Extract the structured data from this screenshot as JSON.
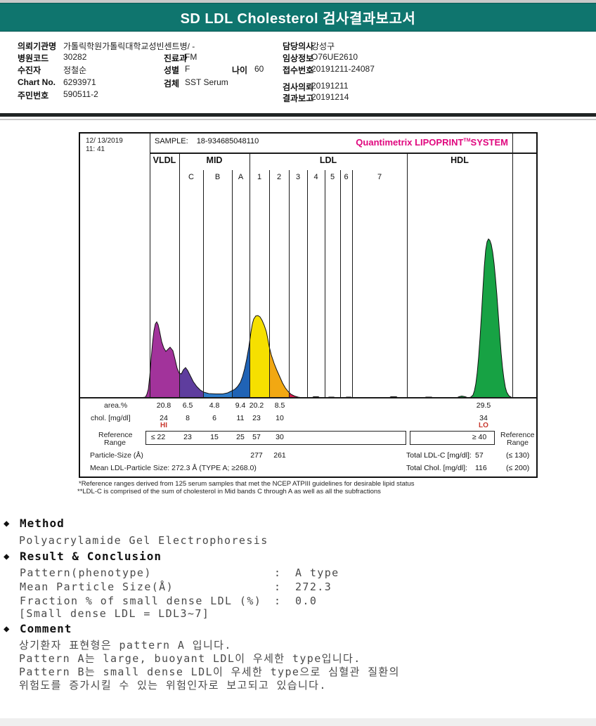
{
  "header": {
    "title": "SD LDL Cholesterol 검사결과보고서"
  },
  "patient": {
    "col1": [
      {
        "label": "의뢰기관명",
        "value": "가톨릭학원가톨릭대학교성빈센트병/ -"
      },
      {
        "label": "병원코드",
        "value": "30282"
      },
      {
        "label": "수진자",
        "value": "정철순"
      },
      {
        "label": "Chart No.",
        "value": "6293971"
      },
      {
        "label": "주민번호",
        "value": "590511-2"
      }
    ],
    "col2": [
      {
        "label": "진료과",
        "value": "FM"
      },
      {
        "label": "성별",
        "value": "F"
      },
      {
        "label": "나이",
        "value": "60"
      },
      {
        "label": "검체",
        "value": "SST Serum"
      }
    ],
    "col3": [
      {
        "label": "담당의사",
        "value": "강성구"
      },
      {
        "label": "임상정보",
        "value": "O76UE2610"
      },
      {
        "label": "접수번호",
        "value": "20191211-24087"
      },
      {
        "label": "검사의뢰",
        "value": "20191211"
      },
      {
        "label": "결과보고",
        "value": "20191214"
      }
    ]
  },
  "chart_data": {
    "type": "area",
    "title": "Quantimetrix LIPOPRINT SYSTEM densitometry scan",
    "date_line1": "12/ 13/2019",
    "date_line2": "11: 41",
    "sample_label": "SAMPLE:",
    "sample_id": "18-934685048110",
    "brand": "Quantimetrix LIPOPRINT",
    "brand_tm": "TM",
    "brand_suffix": "SYSTEM",
    "group_labels": [
      "VLDL",
      "MID",
      "LDL",
      "HDL"
    ],
    "sub_labels": [
      "C",
      "B",
      "A",
      "1",
      "2",
      "3",
      "4",
      "5",
      "6",
      "7"
    ],
    "row_labels": {
      "area": "area.%",
      "chol": "chol. [mg/dl]",
      "ref_l1": "Reference",
      "ref_l2": "Range",
      "particle": "Particle-Size (Å)",
      "mean": "Mean LDL-Particle Size:  272.3 Å  (TYPE A; ≥268.0)"
    },
    "area_pct": {
      "vldl": 20.8,
      "mid_c": 6.5,
      "mid_b": 4.8,
      "mid_a": 9.4,
      "ldl1": 20.2,
      "ldl2": 8.5,
      "hdl": 29.5
    },
    "chol_mg_dl": {
      "vldl": 24,
      "mid_c": 8,
      "mid_b": 6,
      "mid_a": 11,
      "ldl1": 23,
      "ldl2": 10,
      "hdl": 34
    },
    "flags": {
      "vldl": "HI",
      "hdl": "LO"
    },
    "reference_range": {
      "vldl": "≤ 22",
      "mid_c": "23",
      "mid_b": "15",
      "mid_a": "25",
      "ldl1": "57",
      "ldl2": "30",
      "hdl": "≥ 40"
    },
    "particle_size": {
      "ldl1": 277,
      "ldl2": 261
    },
    "totals": {
      "ldl_c_label": "Total LDL-C [mg/dl]:",
      "ldl_c_value": 57,
      "ldl_c_ref": "(≤ 130)",
      "chol_label": "Total Chol. [mg/dl]:",
      "chol_value": 116,
      "chol_ref": "(≤ 200)"
    },
    "colors": {
      "vldl": "#a2339b",
      "mid_c": "#5e3d9e",
      "mid_b": "#2e7ccb",
      "mid_a": "#2063b5",
      "ldl1": "#f6e000",
      "ldl2": "#f2a812",
      "ldl3": "#d4184a",
      "hdl": "#17a244",
      "brand": "#e0077e",
      "flag": "#c8372d"
    }
  },
  "footnotes": [
    "*Reference ranges derived from 125 serum samples that met the NCEP ATPIII guidelines for desirable lipid status",
    "**LDL-C is comprised of the sum of cholesterol in Mid bands C through A as well as all the subfractions"
  ],
  "sections": {
    "bullet": "◆",
    "method": {
      "title": "Method",
      "body": "Polyacrylamide Gel Electrophoresis"
    },
    "result": {
      "title": "Result & Conclusion",
      "rows": [
        {
          "label": "Pattern(phenotype)",
          "colon": ":",
          "value": "A type"
        },
        {
          "label": "Mean Particle Size(Å)",
          "colon": ":",
          "value": "272.3"
        },
        {
          "label": "Fraction % of small dense LDL (%)",
          "colon": ":",
          "value": "0.0"
        }
      ],
      "note": "[Small dense LDL = LDL3~7]"
    },
    "comment": {
      "title": "Comment",
      "lines": [
        "상기환자 표현형은 pattern A 입니다.",
        "Pattern A는 large, buoyant LDL이 우세한 type입니다.",
        "Pattern B는 small dense LDL이 우세한 type으로 심혈관 질환의",
        "위험도를 증가시킬 수 있는 위험인자로 보고되고 있습니다."
      ]
    }
  }
}
